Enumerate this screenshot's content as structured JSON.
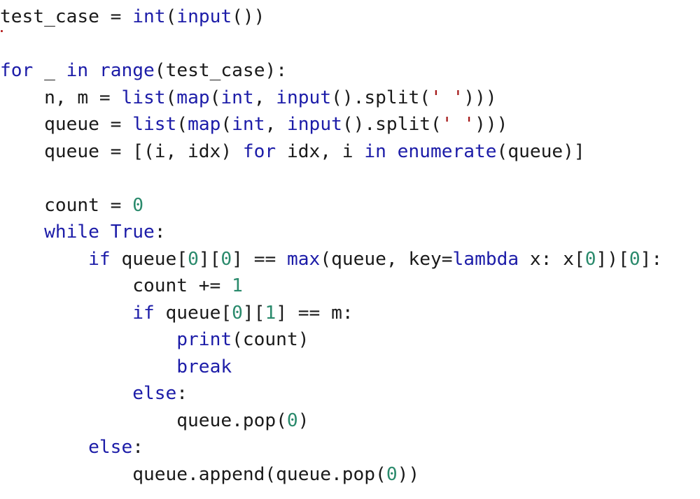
{
  "code": {
    "language": "python",
    "colors": {
      "keyword": "#1c1ca8",
      "builtin": "#1c1ca8",
      "number": "#2a8a6c",
      "string": "#a31515",
      "text": "#1a1a1a"
    },
    "lines": [
      [
        [
          "test_case = ",
          "txt"
        ],
        [
          "int",
          "bi"
        ],
        [
          "(",
          "txt"
        ],
        [
          "input",
          "bi"
        ],
        [
          "())",
          "txt"
        ]
      ],
      [],
      [
        [
          "for",
          "kw"
        ],
        [
          " _ ",
          "txt"
        ],
        [
          "in",
          "kw"
        ],
        [
          " ",
          "txt"
        ],
        [
          "range",
          "bi"
        ],
        [
          "(test_case):",
          "txt"
        ]
      ],
      [
        [
          "    n, m = ",
          "txt"
        ],
        [
          "list",
          "bi"
        ],
        [
          "(",
          "txt"
        ],
        [
          "map",
          "bi"
        ],
        [
          "(",
          "txt"
        ],
        [
          "int",
          "bi"
        ],
        [
          ", ",
          "txt"
        ],
        [
          "input",
          "bi"
        ],
        [
          "().split(",
          "txt"
        ],
        [
          "' '",
          "str"
        ],
        [
          ")))",
          "txt"
        ]
      ],
      [
        [
          "    queue = ",
          "txt"
        ],
        [
          "list",
          "bi"
        ],
        [
          "(",
          "txt"
        ],
        [
          "map",
          "bi"
        ],
        [
          "(",
          "txt"
        ],
        [
          "int",
          "bi"
        ],
        [
          ", ",
          "txt"
        ],
        [
          "input",
          "bi"
        ],
        [
          "().split(",
          "txt"
        ],
        [
          "' '",
          "str"
        ],
        [
          ")))",
          "txt"
        ]
      ],
      [
        [
          "    queue = [(i, idx) ",
          "txt"
        ],
        [
          "for",
          "kw"
        ],
        [
          " idx, i ",
          "txt"
        ],
        [
          "in",
          "kw"
        ],
        [
          " ",
          "txt"
        ],
        [
          "enumerate",
          "bi"
        ],
        [
          "(queue)]",
          "txt"
        ]
      ],
      [],
      [
        [
          "    count = ",
          "txt"
        ],
        [
          "0",
          "num"
        ]
      ],
      [
        [
          "    ",
          "txt"
        ],
        [
          "while",
          "kw"
        ],
        [
          " ",
          "txt"
        ],
        [
          "True",
          "kw"
        ],
        [
          ":",
          "txt"
        ]
      ],
      [
        [
          "        ",
          "txt"
        ],
        [
          "if",
          "kw"
        ],
        [
          " queue[",
          "txt"
        ],
        [
          "0",
          "num"
        ],
        [
          "][",
          "txt"
        ],
        [
          "0",
          "num"
        ],
        [
          "] == ",
          "txt"
        ],
        [
          "max",
          "bi"
        ],
        [
          "(queue, key=",
          "txt"
        ],
        [
          "lambda",
          "kw"
        ],
        [
          " x: x[",
          "txt"
        ],
        [
          "0",
          "num"
        ],
        [
          "])[",
          "txt"
        ],
        [
          "0",
          "num"
        ],
        [
          "]:",
          "txt"
        ]
      ],
      [
        [
          "            count += ",
          "txt"
        ],
        [
          "1",
          "num"
        ]
      ],
      [
        [
          "            ",
          "txt"
        ],
        [
          "if",
          "kw"
        ],
        [
          " queue[",
          "txt"
        ],
        [
          "0",
          "num"
        ],
        [
          "][",
          "txt"
        ],
        [
          "1",
          "num"
        ],
        [
          "] == m:",
          "txt"
        ]
      ],
      [
        [
          "                ",
          "txt"
        ],
        [
          "print",
          "bi"
        ],
        [
          "(count)",
          "txt"
        ]
      ],
      [
        [
          "                ",
          "txt"
        ],
        [
          "break",
          "kw"
        ]
      ],
      [
        [
          "            ",
          "txt"
        ],
        [
          "else",
          "kw"
        ],
        [
          ":",
          "txt"
        ]
      ],
      [
        [
          "                queue.pop(",
          "txt"
        ],
        [
          "0",
          "num"
        ],
        [
          ")",
          "txt"
        ]
      ],
      [
        [
          "        ",
          "txt"
        ],
        [
          "else",
          "kw"
        ],
        [
          ":",
          "txt"
        ]
      ],
      [
        [
          "            queue.append(queue.pop(",
          "txt"
        ],
        [
          "0",
          "num"
        ],
        [
          "))",
          "txt"
        ]
      ]
    ]
  }
}
